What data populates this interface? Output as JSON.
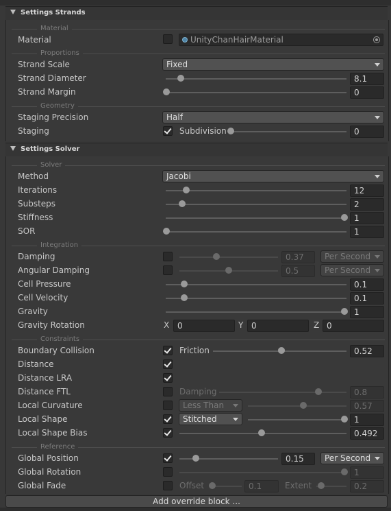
{
  "strands": {
    "header": "Settings Strands",
    "groups": {
      "material": "Material",
      "proportions": "Proportions",
      "geometry": "Geometry"
    },
    "material": {
      "label": "Material",
      "checked": false,
      "value": "UnityChanHairMaterial"
    },
    "strand_scale": {
      "label": "Strand Scale",
      "value": "Fixed"
    },
    "strand_diameter": {
      "label": "Strand Diameter",
      "value": "8.1",
      "slider": 0.06
    },
    "strand_margin": {
      "label": "Strand Margin",
      "value": "0",
      "slider": 0.0
    },
    "staging_precision": {
      "label": "Staging Precision",
      "value": "Half"
    },
    "staging": {
      "label": "Staging",
      "checked": true,
      "sublabel": "Subdivision",
      "value": "0",
      "slider": 0.0
    }
  },
  "solver": {
    "header": "Settings Solver",
    "groups": {
      "solver": "Solver",
      "integration": "Integration",
      "constraints": "Constraints",
      "reference": "Reference"
    },
    "method": {
      "label": "Method",
      "value": "Jacobi"
    },
    "iterations": {
      "label": "Iterations",
      "value": "12"
    },
    "substeps": {
      "label": "Substeps",
      "value": "2"
    },
    "stiffness": {
      "label": "Stiffness",
      "value": "1"
    },
    "sor": {
      "label": "SOR",
      "value": "1"
    },
    "damping": {
      "label": "Damping",
      "checked": false,
      "value": "0.37",
      "unit": "Per Second"
    },
    "angular_damping": {
      "label": "Angular Damping",
      "checked": false,
      "value": "0.5",
      "unit": "Per Second"
    },
    "cell_pressure": {
      "label": "Cell Pressure",
      "value": "0.1"
    },
    "cell_velocity": {
      "label": "Cell Velocity",
      "value": "0.1"
    },
    "gravity": {
      "label": "Gravity",
      "value": "1"
    },
    "gravity_rotation": {
      "label": "Gravity Rotation",
      "x_label": "X",
      "x": "0",
      "y_label": "Y",
      "y": "0",
      "z_label": "Z",
      "z": "0"
    },
    "boundary_collision": {
      "label": "Boundary Collision",
      "checked": true,
      "sublabel": "Friction",
      "value": "0.52"
    },
    "distance": {
      "label": "Distance",
      "checked": true
    },
    "distance_lra": {
      "label": "Distance LRA",
      "checked": true
    },
    "distance_ftl": {
      "label": "Distance FTL",
      "checked": false,
      "sublabel": "Damping",
      "value": "0.8"
    },
    "local_curvature": {
      "label": "Local Curvature",
      "checked": false,
      "mode": "Less Than",
      "value": "0.57"
    },
    "local_shape": {
      "label": "Local Shape",
      "checked": true,
      "mode": "Stitched",
      "value": "1"
    },
    "local_shape_bias": {
      "label": "Local Shape Bias",
      "checked": true,
      "value": "0.492"
    },
    "global_position": {
      "label": "Global Position",
      "checked": true,
      "value": "0.15",
      "unit": "Per Second"
    },
    "global_rotation": {
      "label": "Global Rotation",
      "checked": false,
      "value": "1"
    },
    "global_fade": {
      "label": "Global Fade",
      "checked": false,
      "offset_label": "Offset",
      "offset": "0.1",
      "extent_label": "Extent",
      "extent": "0.2"
    }
  },
  "add_override": "Add override block ..."
}
